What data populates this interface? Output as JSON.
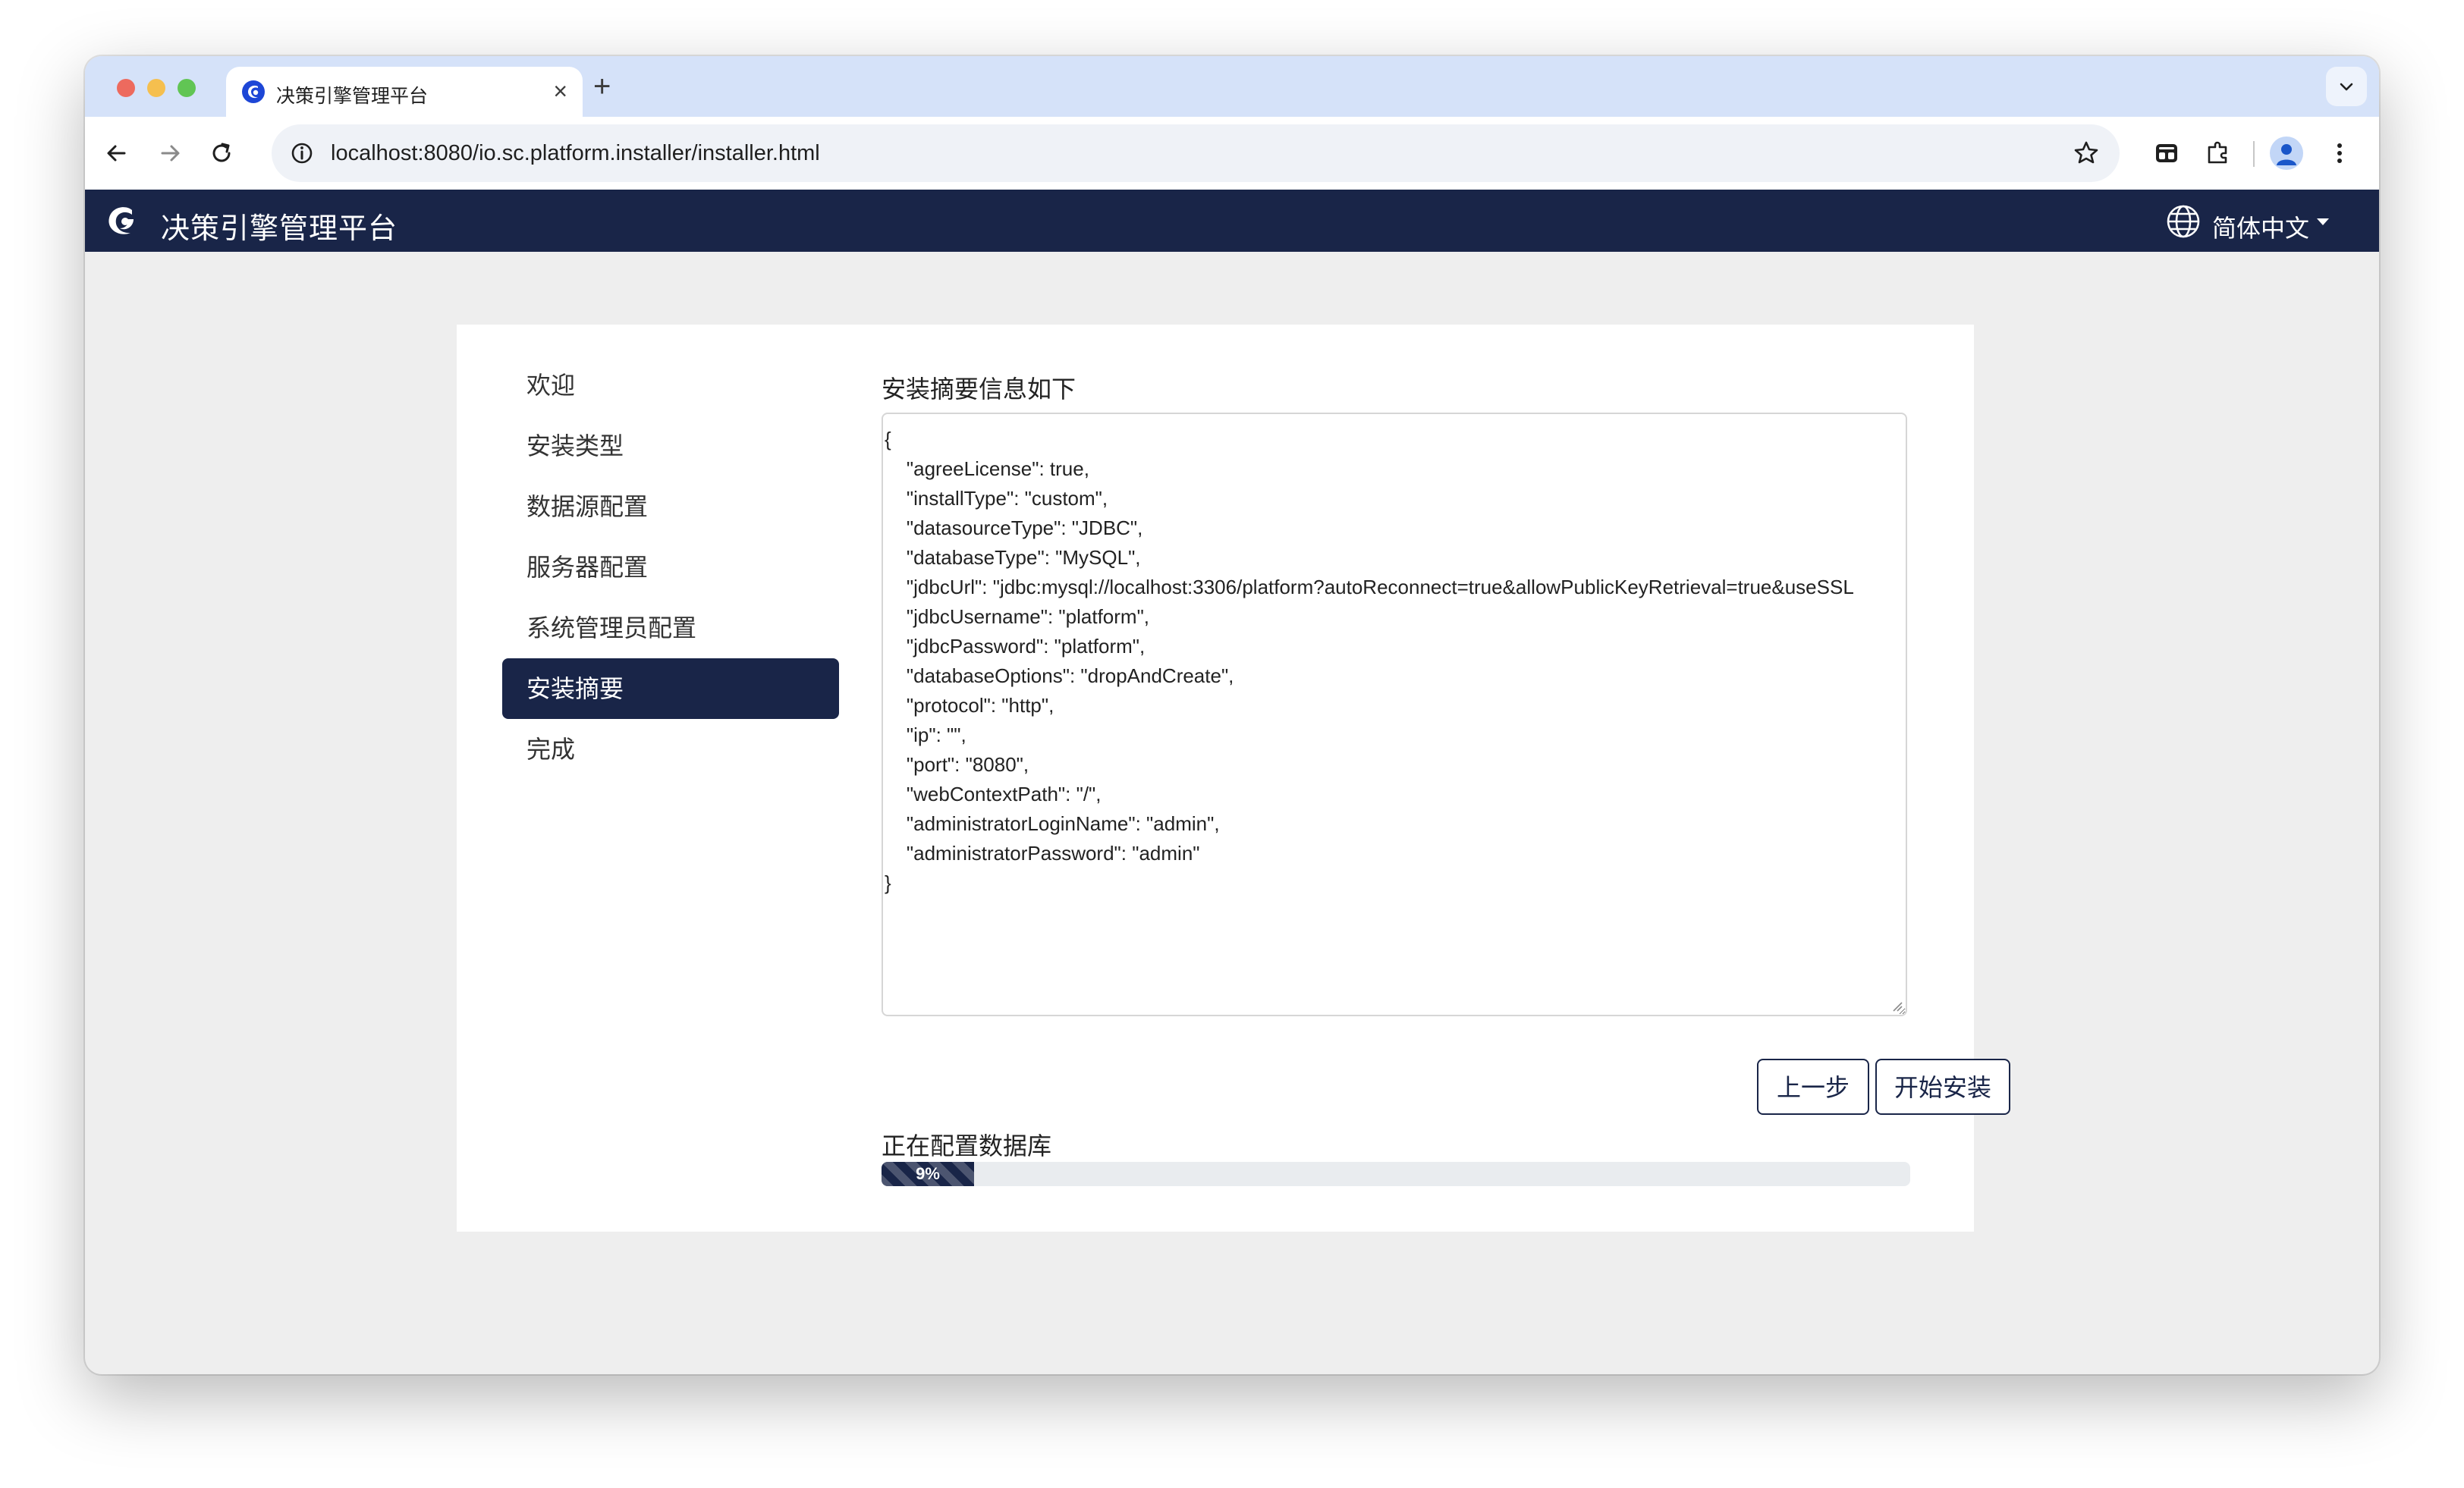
{
  "browser": {
    "tab_title": "决策引擎管理平台",
    "tab_close": "×",
    "new_tab": "+",
    "url": "localhost:8080/io.sc.platform.installer/installer.html"
  },
  "app": {
    "title": "决策引擎管理平台",
    "language": "简体中文"
  },
  "menu": {
    "items": [
      {
        "label": "欢迎"
      },
      {
        "label": "安装类型"
      },
      {
        "label": "数据源配置"
      },
      {
        "label": "服务器配置"
      },
      {
        "label": "系统管理员配置"
      },
      {
        "label": "安装摘要",
        "active": true
      },
      {
        "label": "完成"
      }
    ]
  },
  "summary": {
    "title": "安装摘要信息如下",
    "lines": [
      "{",
      "    \"agreeLicense\": true,",
      "    \"installType\": \"custom\",",
      "    \"datasourceType\": \"JDBC\",",
      "    \"databaseType\": \"MySQL\",",
      "    \"jdbcUrl\": \"jdbc:mysql://localhost:3306/platform?autoReconnect=true&allowPublicKeyRetrieval=true&useSSL",
      "    \"jdbcUsername\": \"platform\",",
      "    \"jdbcPassword\": \"platform\",",
      "    \"databaseOptions\": \"dropAndCreate\",",
      "    \"protocol\": \"http\",",
      "    \"ip\": \"\",",
      "    \"port\": \"8080\",",
      "    \"webContextPath\": \"/\",",
      "    \"administratorLoginName\": \"admin\",",
      "    \"administratorPassword\": \"admin\"",
      "}"
    ]
  },
  "buttons": {
    "prev": "上一步",
    "start": "开始安装"
  },
  "progress": {
    "label": "正在配置数据库",
    "percent": 9,
    "text": "9%"
  },
  "colors": {
    "brand_navy": "#192548",
    "tab_strip": "#d5e2f9",
    "page_bg": "#eeeeee"
  }
}
